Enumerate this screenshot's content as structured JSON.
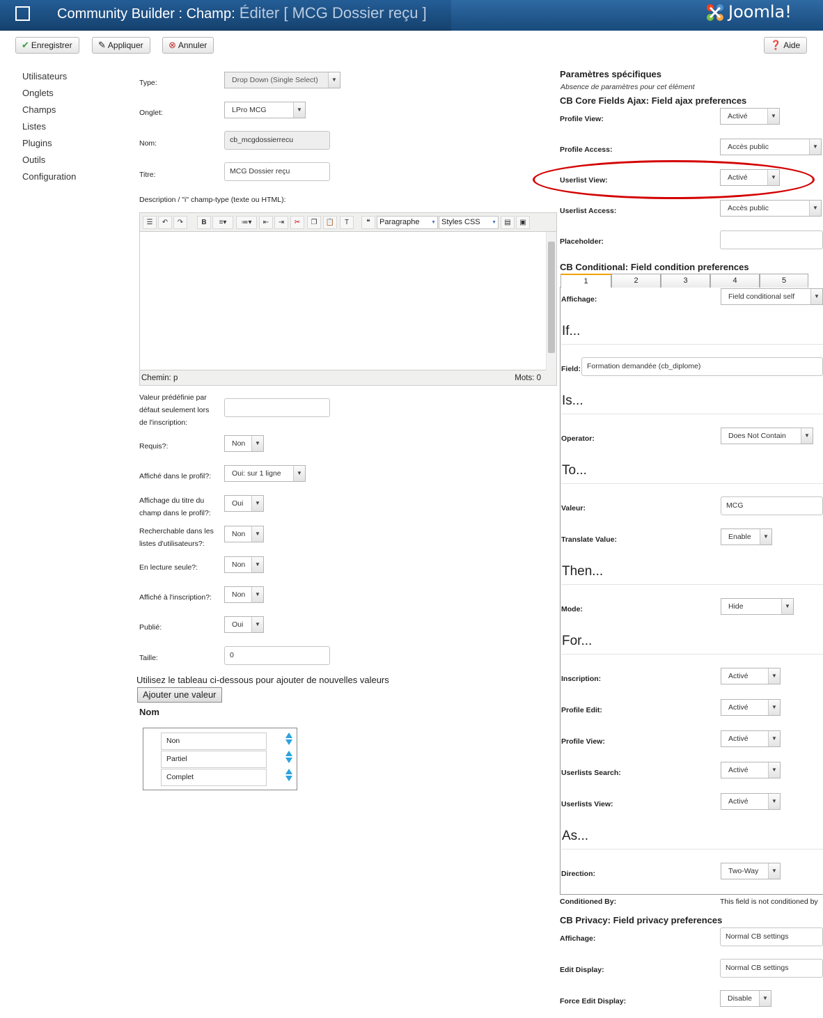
{
  "header": {
    "title_main": "Community Builder : Champ:",
    "title_sub": " Éditer [ MCG Dossier reçu ]",
    "logo_text": "Joomla!"
  },
  "toolbar": {
    "save": "Enregistrer",
    "apply": "Appliquer",
    "cancel": "Annuler",
    "help": "Aide"
  },
  "leftnav": [
    "Utilisateurs",
    "Onglets",
    "Champs",
    "Listes",
    "Plugins",
    "Outils",
    "Configuration"
  ],
  "form": {
    "type_label": "Type:",
    "type_value": "Drop Down (Single Select)",
    "tab_label": "Onglet:",
    "tab_value": "LPro MCG",
    "name_label": "Nom:",
    "name_value": "cb_mcgdossierrecu",
    "title_label": "Titre:",
    "title_value": "MCG Dossier reçu",
    "desc_label": "Description / \"i\" champ-type (texte ou HTML):",
    "editor_format": "Paragraphe",
    "editor_styles": "Styles CSS",
    "editor_path": "Chemin: p",
    "editor_words": "Mots: 0",
    "default_label_1": "Valeur prédéfinie par",
    "default_label_2": "défaut seulement lors",
    "default_label_3": "de l'inscription:",
    "required_label": "Requis?:",
    "required_value": "Non",
    "profile_label": "Affiché dans le profil?:",
    "profile_value": "Oui: sur 1 ligne",
    "titleprof_label_1": "Affichage du titre du",
    "titleprof_label_2": "champ dans le profil?:",
    "titleprof_value": "Oui",
    "search_label_1": "Recherchable dans les",
    "search_label_2": "listes d'utilisateurs?:",
    "search_value": "Non",
    "readonly_label": "En lecture seule?:",
    "readonly_value": "Non",
    "register_label": "Affiché à l'inscription?:",
    "register_value": "Non",
    "published_label": "Publié:",
    "published_value": "Oui",
    "size_label": "Taille:",
    "size_value": "0",
    "values_hint": "Utilisez le tableau ci-dessous pour ajouter de nouvelles valeurs",
    "add_value": "Ajouter une valeur",
    "nom_header": "Nom",
    "values": [
      "Non",
      "Partiel",
      "Complet"
    ]
  },
  "right": {
    "specific_title": "Paramètres spécifiques",
    "specific_note": "Absence de paramètres pour cet élément",
    "ajax_title": "CB Core Fields Ajax: Field ajax preferences",
    "profile_view_label": "Profile View:",
    "profile_view_value": "Activé",
    "profile_access_label": "Profile Access:",
    "profile_access_value": "Accès public",
    "userlist_view_label": "Userlist View:",
    "userlist_view_value": "Activé",
    "userlist_access_label": "Userlist Access:",
    "userlist_access_value": "Accès public",
    "placeholder_label": "Placeholder:",
    "cond_title": "CB Conditional: Field condition preferences",
    "cond_tabs": [
      "1",
      "2",
      "3",
      "4",
      "5"
    ],
    "affichage_label": "Affichage:",
    "affichage_value": "Field conditional self",
    "if": "If...",
    "field_label": "Field:",
    "field_value": "Formation demandée (cb_diplome)",
    "is": "Is...",
    "operator_label": "Operator:",
    "operator_value": "Does Not Contain",
    "to": "To...",
    "valeur_label": "Valeur:",
    "valeur_value": "MCG",
    "translate_label": "Translate Value:",
    "translate_value": "Enable",
    "then": "Then...",
    "mode_label": "Mode:",
    "mode_value": "Hide",
    "for": "For...",
    "inscription_label": "Inscription:",
    "inscription_value": "Activé",
    "profile_edit_label": "Profile Edit:",
    "profile_edit_value": "Activé",
    "profile_view2_label": "Profile View:",
    "profile_view2_value": "Activé",
    "ul_search_label": "Userlists Search:",
    "ul_search_value": "Activé",
    "ul_view_label": "Userlists View:",
    "ul_view_value": "Activé",
    "as": "As...",
    "direction_label": "Direction:",
    "direction_value": "Two-Way",
    "conditioned_label": "Conditioned By:",
    "conditioned_value": "This field is not conditioned by",
    "privacy_title": "CB Privacy: Field privacy preferences",
    "p_affichage_label": "Affichage:",
    "p_affichage_value": "Normal CB settings",
    "edit_display_label": "Edit Display:",
    "edit_display_value": "Normal CB settings",
    "force_edit_label": "Force Edit Display:",
    "force_edit_value": "Disable"
  },
  "colors": {
    "header": "#1b4f84",
    "highlight_ellipse": "#d40000",
    "tab_accent": "#f0a000"
  },
  "icons": {
    "save": "check-icon",
    "apply": "edit-icon",
    "cancel": "cancel-icon",
    "help": "question-icon"
  }
}
